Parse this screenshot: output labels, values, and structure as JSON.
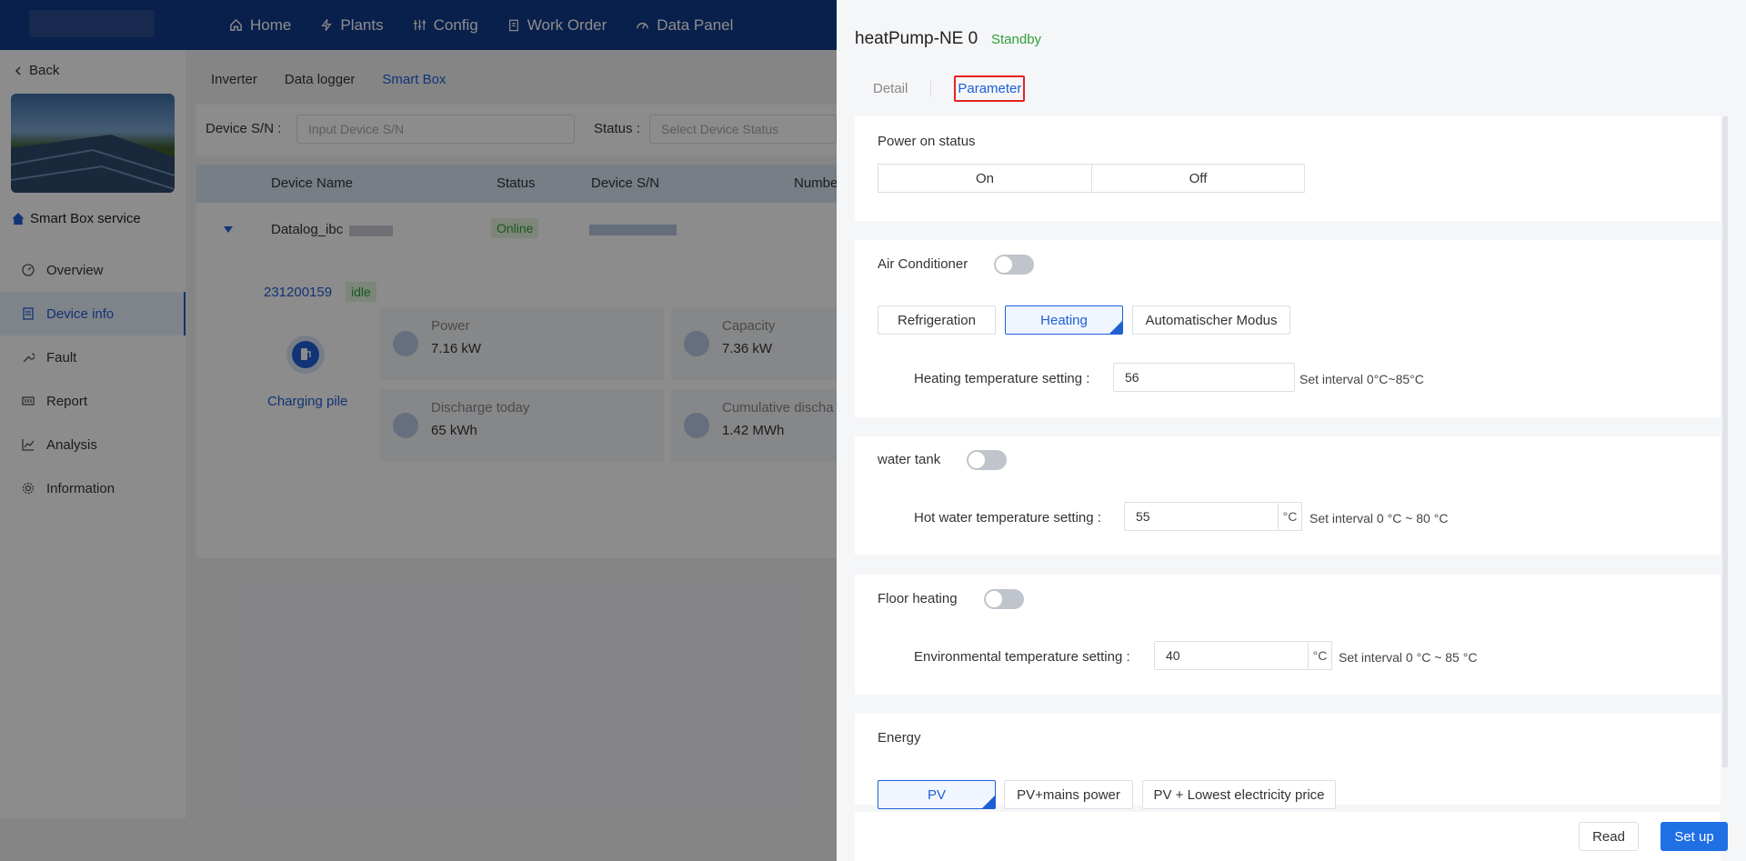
{
  "nav": {
    "items": [
      {
        "label": "Home",
        "icon": "home-icon"
      },
      {
        "label": "Plants",
        "icon": "bolt-icon"
      },
      {
        "label": "Config",
        "icon": "sliders-icon"
      },
      {
        "label": "Work Order",
        "icon": "clipboard-icon"
      },
      {
        "label": "Data Panel",
        "icon": "dashboard-icon"
      }
    ]
  },
  "sidebar": {
    "back_label": "Back",
    "service_label": "Smart Box service",
    "items": [
      {
        "label": "Overview"
      },
      {
        "label": "Device info"
      },
      {
        "label": "Fault"
      },
      {
        "label": "Report"
      },
      {
        "label": "Analysis"
      },
      {
        "label": "Information"
      }
    ]
  },
  "main": {
    "tabs": [
      "Inverter",
      "Data logger",
      "Smart Box"
    ],
    "filter": {
      "sn_label": "Device S/N :",
      "sn_placeholder": "Input Device S/N",
      "status_label": "Status :",
      "status_placeholder": "Select Device Status"
    },
    "table": {
      "headers": [
        "Device Name",
        "Status",
        "Device S/N",
        "Numbe"
      ],
      "row": {
        "name": "Datalog_ibc",
        "status": "Online"
      }
    },
    "detail": {
      "id": "231200159",
      "state": "idle",
      "pile_label": "Charging pile",
      "metrics": [
        {
          "title": "Power",
          "value": "7.16 kW"
        },
        {
          "title": "Capacity",
          "value": "7.36 kW"
        },
        {
          "title": "Discharge today",
          "value": "65 kWh"
        },
        {
          "title": "Cumulative discha",
          "value": "1.42 MWh"
        }
      ]
    }
  },
  "drawer": {
    "title": "heatPump-NE 0",
    "status": "Standby",
    "tabs": {
      "detail": "Detail",
      "parameter": "Parameter"
    },
    "power": {
      "title": "Power on status",
      "on": "On",
      "off": "Off"
    },
    "ac": {
      "title": "Air Conditioner",
      "enabled": false,
      "modes": [
        "Refrigeration",
        "Heating",
        "Automatischer Modus"
      ],
      "selected": "Heating",
      "heating_label": "Heating temperature setting :",
      "heating_value": "56",
      "heating_hint": "Set interval 0°C~85°C"
    },
    "tank": {
      "title": "water tank",
      "enabled": false,
      "label": "Hot water temperature setting :",
      "value": "55",
      "unit": "°C",
      "hint": "Set interval 0 °C ~ 80 °C"
    },
    "floor": {
      "title": "Floor heating",
      "enabled": false,
      "label": "Environmental temperature setting :",
      "value": "40",
      "unit": "°C",
      "hint": "Set interval 0 °C ~ 85 °C"
    },
    "energy": {
      "title": "Energy",
      "options": [
        "PV",
        "PV+mains power",
        "PV + Lowest electricity price"
      ],
      "selected": "PV"
    },
    "footer": {
      "read": "Read",
      "setup": "Set up"
    }
  },
  "colors": {
    "primary": "#1f5fd6",
    "topbar": "#12398a",
    "success": "#2fa03c",
    "highlight": "#e52222"
  }
}
